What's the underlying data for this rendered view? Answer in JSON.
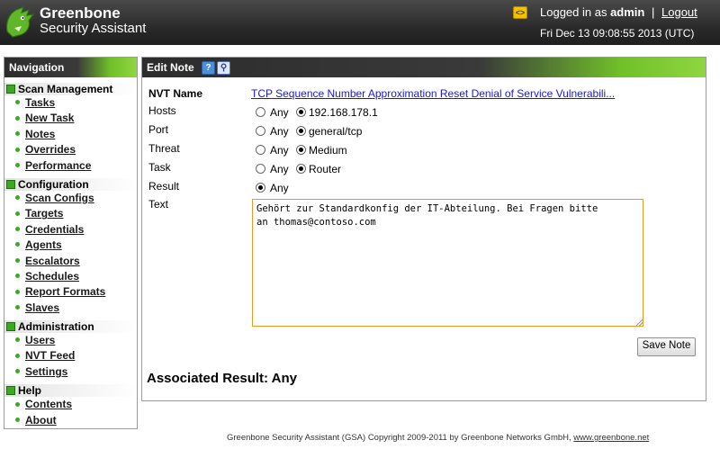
{
  "header": {
    "logo_line1": "Greenbone",
    "logo_line2": "Security Assistant",
    "logged_in_prefix": "Logged in as",
    "username": "admin",
    "separator": "|",
    "logout_label": "Logout",
    "datetime": "Fri Dec 13 09:08:55 2013 (UTC)",
    "icons": {
      "logo": "greenbone-dragon-icon",
      "toggle": "code-toggle-icon"
    }
  },
  "navigation": {
    "title": "Navigation",
    "sections": [
      {
        "title": "Scan Management",
        "items": [
          "Tasks",
          "New Task",
          "Notes",
          "Overrides",
          "Performance"
        ]
      },
      {
        "title": "Configuration",
        "items": [
          "Scan Configs",
          "Targets",
          "Credentials",
          "Agents",
          "Escalators",
          "Schedules",
          "Report Formats",
          "Slaves"
        ]
      },
      {
        "title": "Administration",
        "items": [
          "Users",
          "NVT Feed",
          "Settings"
        ]
      },
      {
        "title": "Help",
        "items": [
          "Contents",
          "About"
        ]
      }
    ]
  },
  "edit_note": {
    "title": "Edit Note",
    "icons": {
      "help": "help-icon",
      "details": "magnifier-icon"
    },
    "nvt_name_label": "NVT Name",
    "nvt_name_value": "TCP Sequence Number Approximation Reset Denial of Service Vulnerabili...",
    "hosts": {
      "label": "Hosts",
      "any_label": "Any",
      "value": "192.168.178.1",
      "selected": "value"
    },
    "port": {
      "label": "Port",
      "any_label": "Any",
      "value": "general/tcp",
      "selected": "value"
    },
    "threat": {
      "label": "Threat",
      "any_label": "Any",
      "value": "Medium",
      "selected": "value"
    },
    "task": {
      "label": "Task",
      "any_label": "Any",
      "value": "Router",
      "selected": "value"
    },
    "result": {
      "label": "Result",
      "any_label": "Any",
      "selected": "any"
    },
    "text_label": "Text",
    "text_value": "Gehört zur Standardkonfig der IT-Abteilung. Bei Fragen bitte\nan thomas@contoso.com",
    "save_label": "Save Note",
    "associated_result": "Associated Result: Any"
  },
  "footer": {
    "text": "Greenbone Security Assistant (GSA) Copyright 2009-2011 by Greenbone Networks GmbH,",
    "link": "www.greenbone.net"
  },
  "colors": {
    "accent_green": "#8fd640",
    "header_dark": "#2b2b2b",
    "link_blue": "#1a1ad0",
    "textarea_border": "#e39a2b"
  }
}
